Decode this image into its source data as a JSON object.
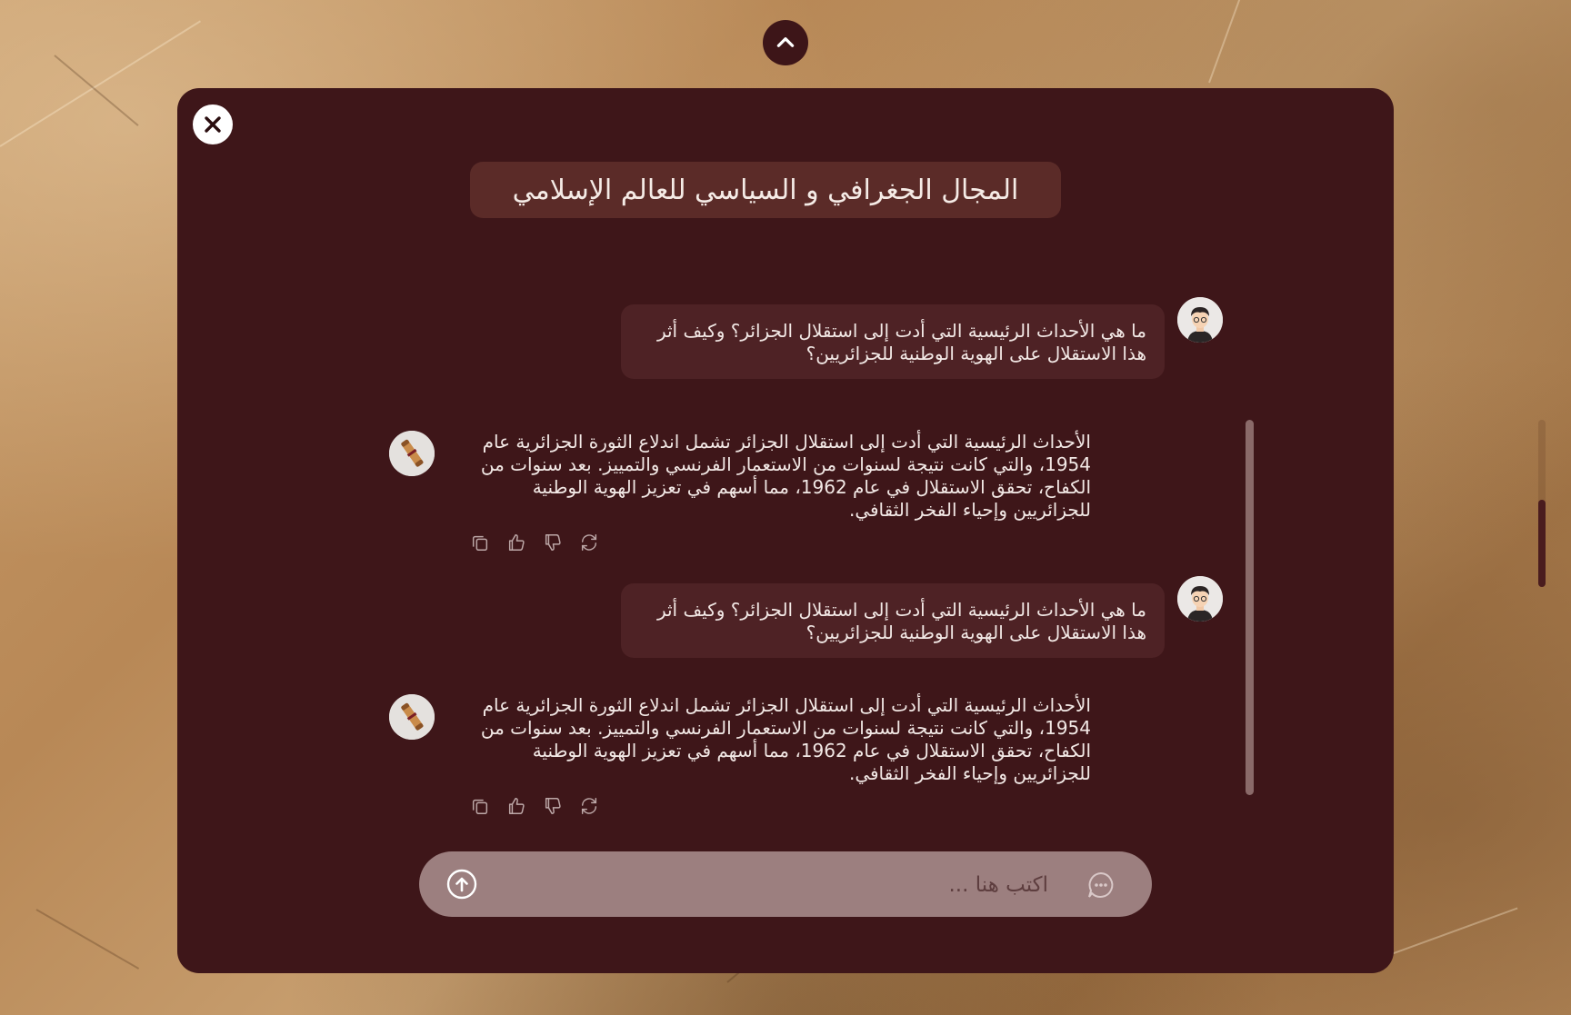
{
  "chat": {
    "title": "المجال الجغرافي و السياسي للعالم الإسلامي",
    "messages": [
      {
        "role": "user",
        "text": "ما هي الأحداث الرئيسية التي أدت إلى استقلال الجزائر؟ وكيف أثر هذا الاستقلال على الهوية الوطنية للجزائريين؟"
      },
      {
        "role": "assistant",
        "text": "الأحداث الرئيسية التي أدت إلى استقلال الجزائر تشمل اندلاع الثورة الجزائرية عام 1954، والتي كانت نتيجة لسنوات من الاستعمار الفرنسي والتمييز. بعد سنوات من الكفاح، تحقق الاستقلال في عام 1962، مما أسهم في تعزيز الهوية الوطنية للجزائريين وإحياء الفخر الثقافي."
      },
      {
        "role": "user",
        "text": "ما هي الأحداث الرئيسية التي أدت إلى استقلال الجزائر؟ وكيف أثر هذا الاستقلال على الهوية الوطنية للجزائريين؟"
      },
      {
        "role": "assistant",
        "text": "الأحداث الرئيسية التي أدت إلى استقلال الجزائر تشمل اندلاع الثورة الجزائرية عام 1954، والتي كانت نتيجة لسنوات من الاستعمار الفرنسي والتمييز. بعد سنوات من الكفاح، تحقق الاستقلال في عام 1962، مما أسهم في تعزيز الهوية الوطنية للجزائريين وإحياء الفخر الثقافي."
      }
    ],
    "message_actions": [
      "copy-icon",
      "thumbs-up-icon",
      "thumbs-down-icon",
      "regenerate-icon"
    ]
  },
  "input": {
    "placeholder": "اكتب هنا ..."
  },
  "icons": {
    "top_toggle": "chevron-up-icon",
    "close": "close-icon",
    "send": "send-arrow-up-icon",
    "chat": "chat-bubble-icon",
    "user_avatar": "user-avatar",
    "bot_avatar": "scroll-avatar"
  },
  "colors": {
    "panel": "#3e1619",
    "title_bg": "#5b2b28",
    "user_bubble": "#4e2225",
    "input_bg": "#9c7f7f",
    "text": "#f2e8e5"
  }
}
